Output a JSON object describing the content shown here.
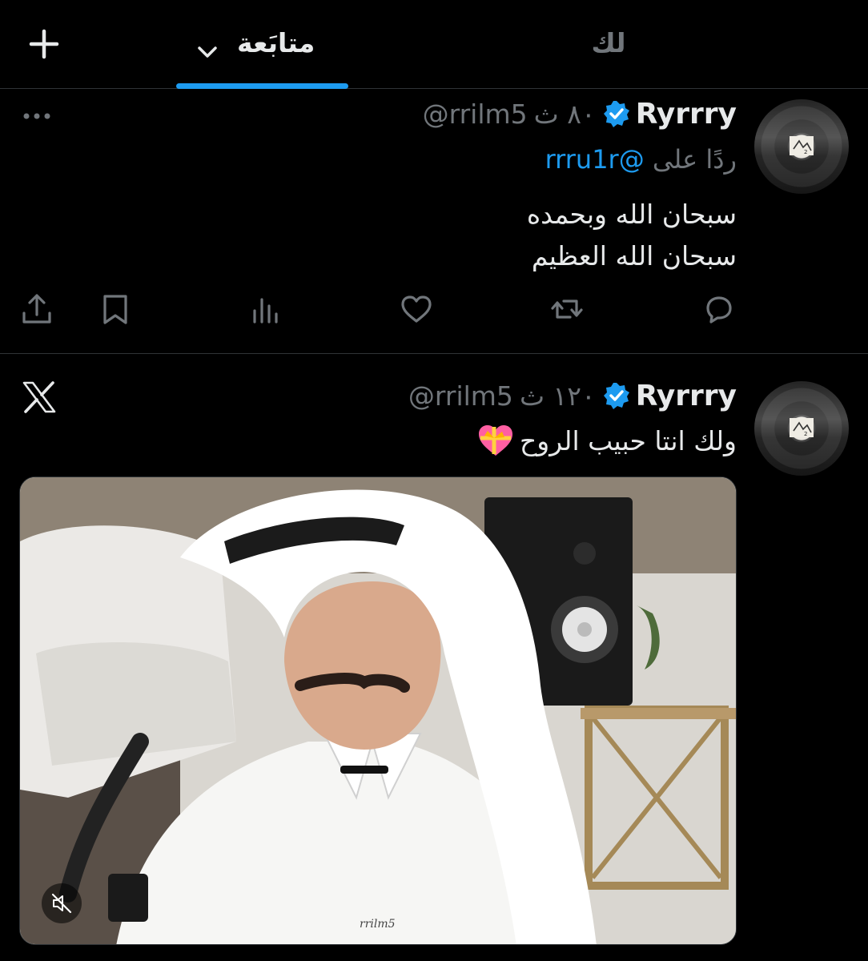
{
  "tabs": {
    "for_you": "لك",
    "following": "متابَعة"
  },
  "tweets": [
    {
      "author_name": "Ryrrry",
      "handle": "@rrilm5",
      "time": "٨٠ ث",
      "reply_prefix": "ردًا على",
      "reply_to": "@rrru1r",
      "text_lines": [
        "سبحان الله وبحمده",
        "سبحان الله العظيم"
      ]
    },
    {
      "author_name": "Ryrrry",
      "handle": "@rrilm5",
      "time": "١٢٠ ث",
      "text": "ولك انتا حبيب الروح",
      "media_watermark": "rrilm5"
    }
  ],
  "colors": {
    "background": "#000000",
    "text": "#e7e9ea",
    "muted": "#71767b",
    "accent": "#1d9bf0",
    "border": "#2f3336"
  },
  "icons": [
    "plus-icon",
    "chevron-down-icon",
    "verified-badge-icon",
    "more-icon",
    "x-logo-icon",
    "reply-icon",
    "retweet-icon",
    "like-icon",
    "views-icon",
    "bookmark-icon",
    "share-icon",
    "muted-speaker-icon",
    "heart-ribbon-emoji"
  ]
}
